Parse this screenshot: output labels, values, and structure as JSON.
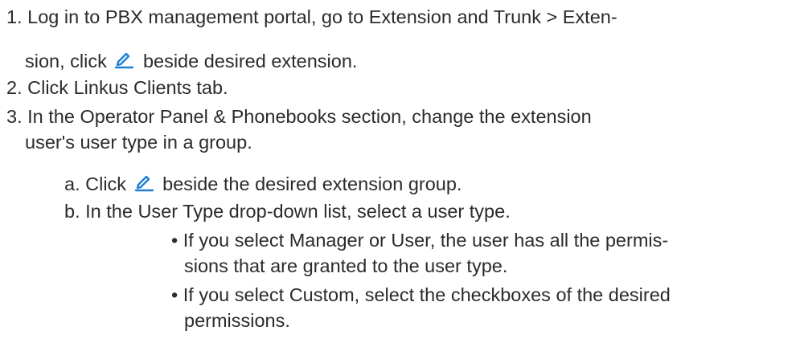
{
  "icons": {
    "edit": "pencil-edit-icon",
    "accent": "#1e7fd6"
  },
  "steps": [
    {
      "number": "1.",
      "line1": "Log in to PBX management portal, go to Extension and Trunk > Exten-",
      "line2_before": "sion, click",
      "line2_after": "beside desired extension."
    },
    {
      "number": "2.",
      "text": "Click Linkus Clients tab."
    },
    {
      "number": "3.",
      "line1": "In the Operator Panel & Phonebooks section, change the extension",
      "line2": "user's user type in a group.",
      "substeps": [
        {
          "letter": "a.",
          "before": "Click",
          "after": "beside the desired extension group."
        },
        {
          "letter": "b.",
          "text": "In the User Type drop-down list, select a user type.",
          "bullets": [
            {
              "line1": "If you select Manager or User, the user has all the permis-",
              "line2": "sions that are granted to the user type."
            },
            {
              "line1": "If you select Custom, select the checkboxes of the desired",
              "line2": "permissions."
            }
          ]
        }
      ]
    }
  ]
}
